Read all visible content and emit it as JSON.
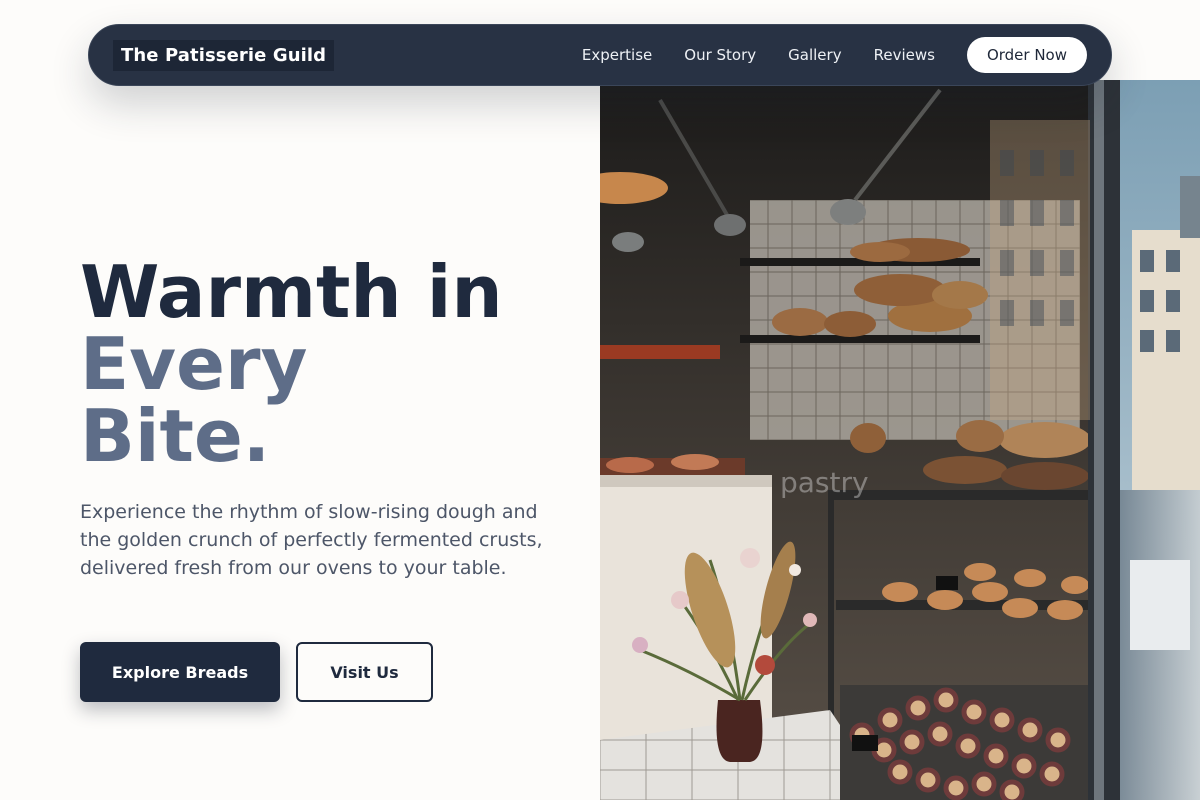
{
  "nav": {
    "brand": "The Patisserie Guild",
    "links": [
      "Expertise",
      "Our Story",
      "Gallery",
      "Reviews"
    ],
    "cta": "Order Now"
  },
  "hero": {
    "title_line1": "Warmth in",
    "title_line2": "Every",
    "title_line3": "Bite.",
    "description": "Experience the rhythm of slow-rising dough and the golden crunch of perfectly fermented crusts, delivered fresh from our ovens to your table.",
    "primary_button": "Explore Breads",
    "secondary_button": "Visit Us",
    "image_window_text": "pastry"
  },
  "colors": {
    "nav_bg": "#283244",
    "title_dark": "#1f2a3e",
    "title_accent": "#5e6d88",
    "page_bg": "#fdfcfa"
  }
}
